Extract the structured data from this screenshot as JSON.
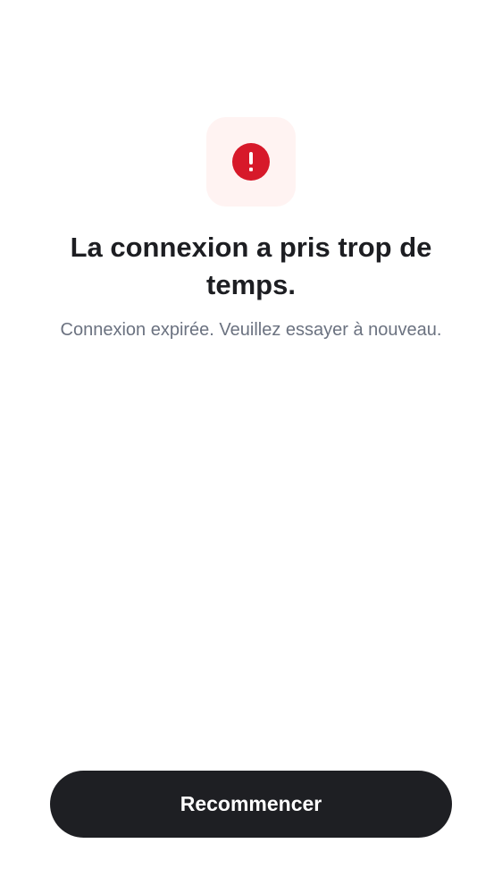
{
  "error": {
    "icon": "alert-circle-icon",
    "title": "La connexion a pris trop de temps.",
    "message": "Connexion expirée. Veuillez essayer à nouveau."
  },
  "actions": {
    "restart_label": "Recommencer"
  },
  "colors": {
    "background": "#FFFFFF",
    "icon_tile": "#FFF3F2",
    "alert": "#D7192A",
    "title": "#1D1E22",
    "subtitle": "#6B7280",
    "button": "#1E1F23",
    "button_text": "#FFFFFF"
  }
}
